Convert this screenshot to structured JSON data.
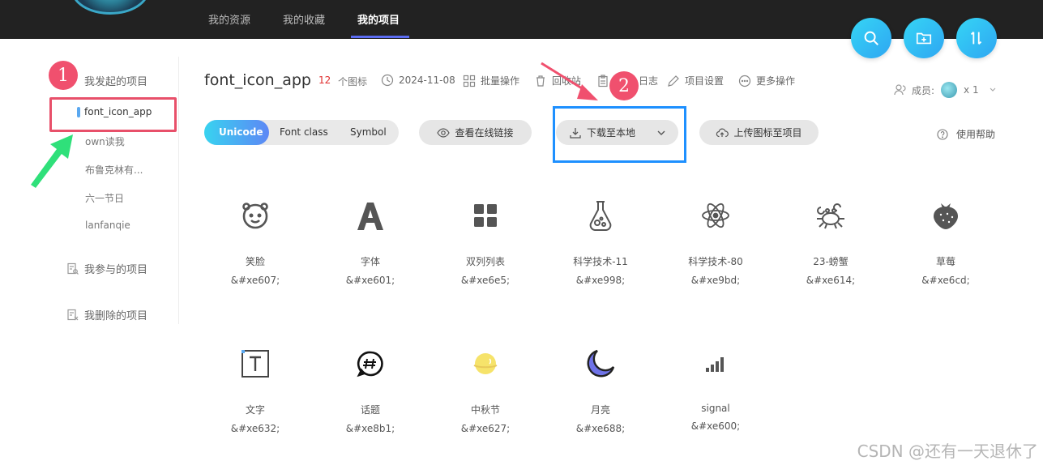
{
  "nav": {
    "tabs": [
      {
        "label": "我的资源"
      },
      {
        "label": "我的收藏"
      },
      {
        "label": "我的项目"
      }
    ]
  },
  "sidebar": {
    "groups": [
      {
        "label": "我发起的项目"
      },
      {
        "label": "我参与的项目"
      },
      {
        "label": "我删除的项目"
      }
    ],
    "items": [
      {
        "label": "font_icon_app"
      },
      {
        "label": "own读我"
      },
      {
        "label": "布鲁克林有..."
      },
      {
        "label": "六一节日"
      },
      {
        "label": "lanfanqie"
      }
    ]
  },
  "annotations": {
    "one": "1",
    "two": "2"
  },
  "header": {
    "title": "font_icon_app",
    "icon_count": "12",
    "icon_count_label": "个图标",
    "date": "2024-11-08",
    "batch": "批量操作",
    "recycle": "回收站",
    "log": "日志",
    "settings": "项目设置",
    "more": "更多操作",
    "members_label": "成员:",
    "members_count": "x 1"
  },
  "toolbar": {
    "tabs": [
      {
        "label": "Unicode"
      },
      {
        "label": "Font class"
      },
      {
        "label": "Symbol"
      }
    ],
    "view_link": "查看在线链接",
    "download": "下载至本地",
    "upload": "上传图标至项目",
    "help": "使用帮助"
  },
  "icons": [
    {
      "name": "笑脸",
      "code": "&#xe607;",
      "icon": "smile-bear-icon"
    },
    {
      "name": "字体",
      "code": "&#xe601;",
      "icon": "font-a-icon"
    },
    {
      "name": "双列列表",
      "code": "&#xe6e5;",
      "icon": "grid-list-icon"
    },
    {
      "name": "科学技术-11",
      "code": "&#xe998;",
      "icon": "flask-icon"
    },
    {
      "name": "科学技术-80",
      "code": "&#xe9bd;",
      "icon": "atom-icon"
    },
    {
      "name": "23-螃蟹",
      "code": "&#xe614;",
      "icon": "crab-icon"
    },
    {
      "name": "草莓",
      "code": "&#xe6cd;",
      "icon": "strawberry-icon"
    },
    {
      "name": "文字",
      "code": "&#xe632;",
      "icon": "text-box-icon"
    },
    {
      "name": "话题",
      "code": "&#xe8b1;",
      "icon": "hashtag-icon"
    },
    {
      "name": "中秋节",
      "code": "&#xe627;",
      "icon": "mooncake-icon"
    },
    {
      "name": "月亮",
      "code": "&#xe688;",
      "icon": "moon-icon"
    },
    {
      "name": "signal",
      "code": "&#xe600;",
      "icon": "signal-icon"
    }
  ],
  "colors": {
    "accent": "#5b6cf2",
    "count_red": "#e02d2d",
    "annotation_red": "#f0506e",
    "highlight_blue": "#1e90ff"
  },
  "watermark": "CSDN @还有一天退休了"
}
